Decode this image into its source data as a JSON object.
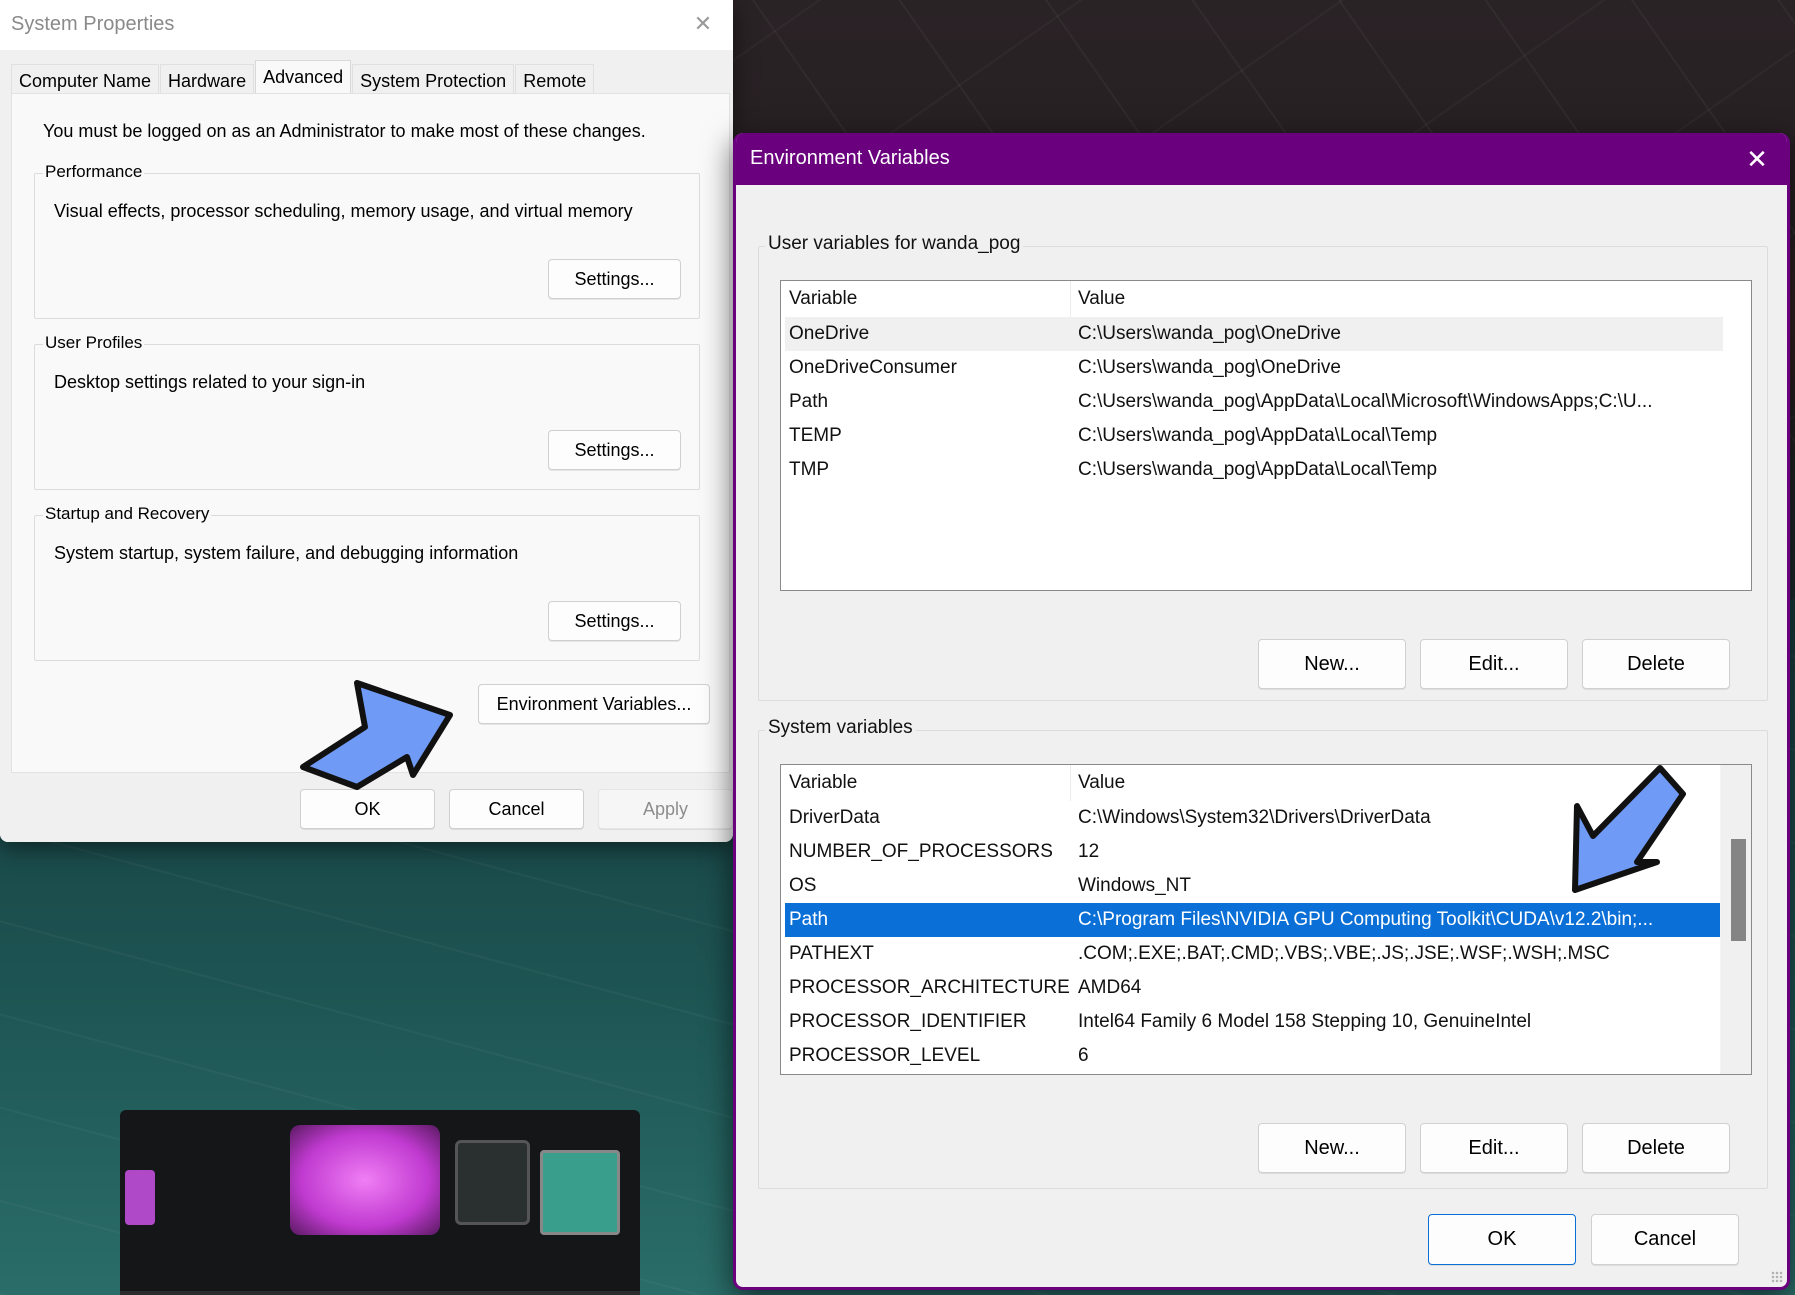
{
  "system_properties": {
    "title": "System Properties",
    "close_glyph": "✕",
    "tabs": [
      {
        "label": "Computer Name",
        "active": false
      },
      {
        "label": "Hardware",
        "active": false
      },
      {
        "label": "Advanced",
        "active": true
      },
      {
        "label": "System Protection",
        "active": false
      },
      {
        "label": "Remote",
        "active": false
      }
    ],
    "admin_note": "You must be logged on as an Administrator to make most of these changes.",
    "groups": [
      {
        "title": "Performance",
        "description": "Visual effects, processor scheduling, memory usage, and virtual memory",
        "button": "Settings..."
      },
      {
        "title": "User Profiles",
        "description": "Desktop settings related to your sign-in",
        "button": "Settings..."
      },
      {
        "title": "Startup and Recovery",
        "description": "System startup, system failure, and debugging information",
        "button": "Settings..."
      }
    ],
    "env_button": "Environment Variables...",
    "footer": {
      "ok": "OK",
      "cancel": "Cancel",
      "apply": "Apply"
    }
  },
  "environment_variables": {
    "title": "Environment Variables",
    "close_glyph": "✕",
    "title_bar_color": "#6b007f",
    "user_group": {
      "title": "User variables for wanda_pog",
      "columns": {
        "variable": "Variable",
        "value": "Value"
      },
      "rows": [
        {
          "variable": "OneDrive",
          "value": "C:\\Users\\wanda_pog\\OneDrive",
          "state": "hover"
        },
        {
          "variable": "OneDriveConsumer",
          "value": "C:\\Users\\wanda_pog\\OneDrive",
          "state": ""
        },
        {
          "variable": "Path",
          "value": "C:\\Users\\wanda_pog\\AppData\\Local\\Microsoft\\WindowsApps;C:\\U...",
          "state": ""
        },
        {
          "variable": "TEMP",
          "value": "C:\\Users\\wanda_pog\\AppData\\Local\\Temp",
          "state": ""
        },
        {
          "variable": "TMP",
          "value": "C:\\Users\\wanda_pog\\AppData\\Local\\Temp",
          "state": ""
        }
      ],
      "buttons": {
        "new": "New...",
        "edit": "Edit...",
        "delete": "Delete"
      }
    },
    "system_group": {
      "title": "System variables",
      "columns": {
        "variable": "Variable",
        "value": "Value"
      },
      "rows": [
        {
          "variable": "DriverData",
          "value": "C:\\Windows\\System32\\Drivers\\DriverData",
          "state": ""
        },
        {
          "variable": "NUMBER_OF_PROCESSORS",
          "value": "12",
          "state": ""
        },
        {
          "variable": "OS",
          "value": "Windows_NT",
          "state": ""
        },
        {
          "variable": "Path",
          "value": "C:\\Program Files\\NVIDIA GPU Computing Toolkit\\CUDA\\v12.2\\bin;...",
          "state": "selected"
        },
        {
          "variable": "PATHEXT",
          "value": ".COM;.EXE;.BAT;.CMD;.VBS;.VBE;.JS;.JSE;.WSF;.WSH;.MSC",
          "state": ""
        },
        {
          "variable": "PROCESSOR_ARCHITECTURE",
          "value": "AMD64",
          "state": ""
        },
        {
          "variable": "PROCESSOR_IDENTIFIER",
          "value": "Intel64 Family 6 Model 158 Stepping 10, GenuineIntel",
          "state": ""
        },
        {
          "variable": "PROCESSOR_LEVEL",
          "value": "6",
          "state": ""
        }
      ],
      "buttons": {
        "new": "New...",
        "edit": "Edit...",
        "delete": "Delete"
      }
    },
    "footer": {
      "ok": "OK",
      "cancel": "Cancel"
    },
    "selection_color": "#0a6fd6"
  },
  "annotations": {
    "arrow_color": "#6f9af5"
  }
}
